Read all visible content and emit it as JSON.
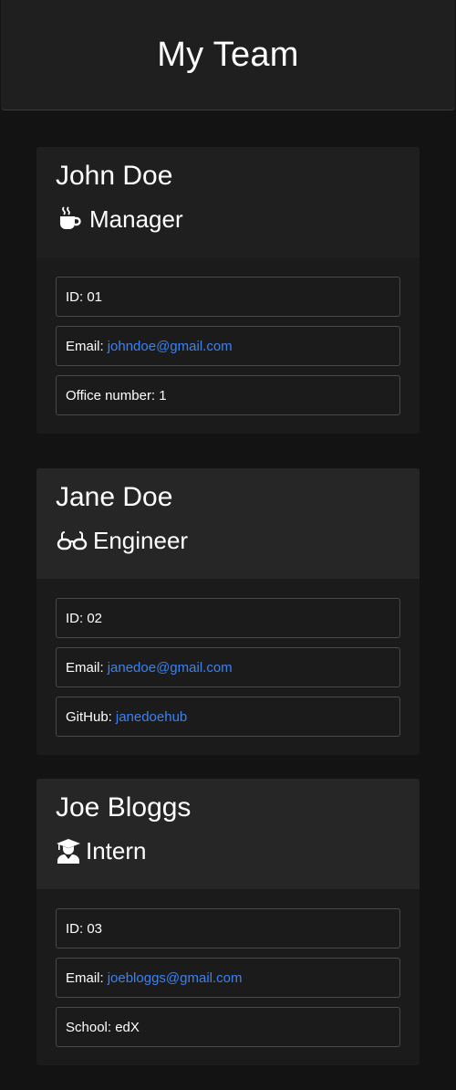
{
  "page": {
    "title": "My Team"
  },
  "team": [
    {
      "name": "John Doe",
      "role": "Manager",
      "icon": "coffee-icon",
      "id_text": "ID: 01",
      "email_label": "Email:",
      "email": "johndoe@gmail.com",
      "extra_text": "Office number: 1"
    },
    {
      "name": "Jane Doe",
      "role": "Engineer",
      "icon": "glasses-icon",
      "id_text": "ID: 02",
      "email_label": "Email:",
      "email": "janedoe@gmail.com",
      "extra_label": "GitHub:",
      "extra_link": "janedoehub"
    },
    {
      "name": "Joe Bloggs",
      "role": "Intern",
      "icon": "graduate-icon",
      "id_text": "ID: 03",
      "email_label": "Email:",
      "email": "joebloggs@gmail.com",
      "extra_text": "School: edX"
    }
  ],
  "colors": {
    "background": "#131313",
    "card": "#1b1b1b",
    "link": "#3b82f0"
  }
}
